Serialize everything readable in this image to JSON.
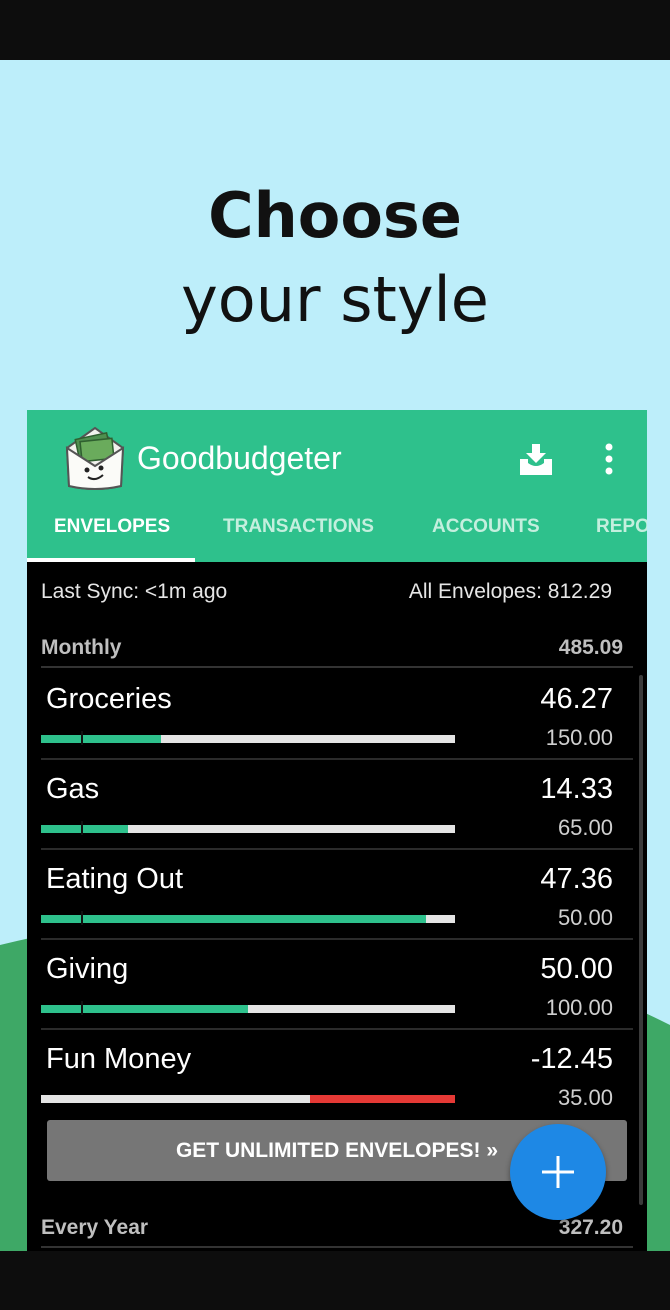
{
  "promo": {
    "headline_line1": "Choose",
    "headline_line2": "your style",
    "background_color": "#bdeefa",
    "hill_color": "#3ea866"
  },
  "app": {
    "title": "Goodbudgeter",
    "accent_color": "#2ec18c",
    "icons": [
      "logo-icon",
      "inbox-download-icon",
      "more-vert-icon",
      "add-icon"
    ]
  },
  "tabs": [
    {
      "label": "ENVELOPES",
      "active": true
    },
    {
      "label": "TRANSACTIONS",
      "active": false
    },
    {
      "label": "ACCOUNTS",
      "active": false
    },
    {
      "label": "REPO",
      "active": false
    }
  ],
  "sync": {
    "last_sync": "Last Sync: <1m ago",
    "all_envelopes": "All Envelopes: 812.29"
  },
  "groups": [
    {
      "name": "Monthly",
      "amount": "485.09"
    },
    {
      "name": "Every Year",
      "amount": "327.20"
    }
  ],
  "envelopes": [
    {
      "name": "Groceries",
      "balance": "46.27",
      "target": "150.00",
      "fill_fraction": 0.29,
      "status": "ok"
    },
    {
      "name": "Gas",
      "balance": "14.33",
      "target": "65.00",
      "fill_fraction": 0.21,
      "status": "ok"
    },
    {
      "name": "Eating Out",
      "balance": "47.36",
      "target": "50.00",
      "fill_fraction": 0.93,
      "status": "ok"
    },
    {
      "name": "Giving",
      "balance": "50.00",
      "target": "100.00",
      "fill_fraction": 0.5,
      "status": "ok"
    },
    {
      "name": "Fun Money",
      "balance": "-12.45",
      "target": "35.00",
      "fill_fraction": 0.35,
      "status": "overspent"
    }
  ],
  "colors": {
    "bar_ok": "#2ec18c",
    "bar_overspent": "#e53935",
    "fab": "#1e88e5"
  },
  "cta_label": "GET UNLIMITED ENVELOPES! »"
}
